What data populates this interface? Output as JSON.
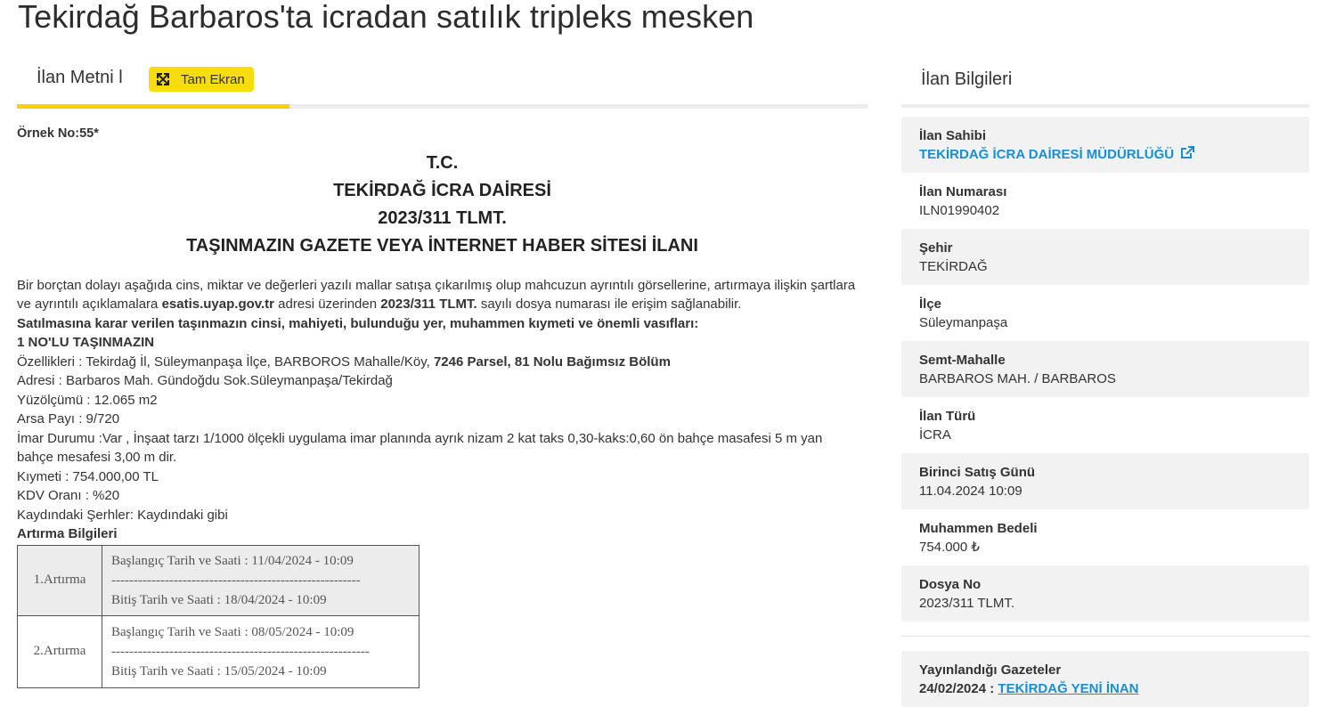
{
  "page": {
    "title": "Tekirdağ Barbaros'ta icradan satılık tripleks mesken"
  },
  "tabs": {
    "label": "İlan Metni l",
    "fullscreen_label": "Tam Ekran"
  },
  "document": {
    "ornek_no": "Örnek No:55*",
    "header_lines": [
      "T.C.",
      "TEKİRDAĞ İCRA DAİRESİ",
      "2023/311 TLMT.",
      "TAŞINMAZIN GAZETE VEYA İNTERNET HABER SİTESİ İLANI"
    ],
    "intro_1": "Bir borçtan dolayı aşağıda cins, miktar ve değerleri yazılı mallar satışa çıkarılmış olup mahcuzun ayrıntılı görsellerine, artırmaya ilişkin şartlara ve ayrıntılı açıklamalara ",
    "intro_site": "esatis.uyap.gov.tr",
    "intro_2": " adresi üzerinden ",
    "intro_file": "2023/311 TLMT.",
    "intro_3": " sayılı dosya numarası ile erişim sağlanabilir.",
    "bold_heading": "Satılmasına karar verilen taşınmazın cinsi, mahiyeti, bulunduğu yer, muhammen kıymeti ve önemli vasıfları:",
    "item_title": "1 NO'LU TAŞINMAZIN",
    "ozellik_prefix": "Özellikleri : Tekirdağ İl, Süleymanpaşa İlçe, BARBOROS Mahalle/Köy, ",
    "ozellik_bold": "7246 Parsel, 81 Nolu Bağımsız Bölüm",
    "lines": [
      "Adresi : Barbaros Mah. Gündoğdu Sok.Süleymanpaşa/Tekirdağ",
      "Yüzölçümü : 12.065 m2",
      "Arsa Payı : 9/720",
      "İmar Durumu :Var , İnşaat tarzı 1/1000 ölçekli uygulama imar planında ayrık nizam 2 kat taks 0,30-kaks:0,60 ön bahçe masafesi 5 m yan bahçe mesafesi 3,00 m dir.",
      "Kıymeti : 754.000,00 TL",
      "KDV Oranı : %20",
      "Kaydındaki Şerhler: Kaydındaki gibi"
    ],
    "auction_heading": "Artırma Bilgileri",
    "auctions": [
      {
        "name": "1.Artırma",
        "start": "Başlangıç Tarih ve Saati : 11/04/2024 - 10:09",
        "dashes": "--------------------------------------------------------",
        "end": "Bitiş Tarih ve Saati : 18/04/2024 - 10:09"
      },
      {
        "name": "2.Artırma",
        "start": "Başlangıç Tarih ve Saati : 08/05/2024 - 10:09",
        "dashes": "----------------------------------------------------------",
        "end": "Bitiş Tarih ve Saati : 15/05/2024 - 10:09"
      }
    ]
  },
  "sidebar": {
    "title": "İlan Bilgileri",
    "owner_label": "İlan Sahibi",
    "owner_value": "TEKİRDAĞ İCRA DAİRESİ MÜDÜRLÜĞÜ",
    "fields": [
      {
        "label": "İlan Numarası",
        "value": "ILN01990402"
      },
      {
        "label": "Şehir",
        "value": "TEKİRDAĞ"
      },
      {
        "label": "İlçe",
        "value": "Süleymanpaşa"
      },
      {
        "label": "Semt-Mahalle",
        "value": "BARBAROS MAH. / BARBAROS"
      },
      {
        "label": "İlan Türü",
        "value": "İCRA"
      },
      {
        "label": "Birinci Satış Günü",
        "value": "11.04.2024 10:09"
      },
      {
        "label": "Muhammen Bedeli",
        "value": "754.000 ₺"
      },
      {
        "label": "Dosya No",
        "value": "2023/311 TLMT."
      }
    ],
    "newspapers_label": "Yayınlandığı Gazeteler",
    "newspaper_date": "24/02/2024 : ",
    "newspaper_name": "TEKİRDAĞ YENİ İNAN"
  },
  "colors": {
    "accent_yellow": "#f7dc0f",
    "link_blue": "#1a8fd0",
    "card_bg": "#f2f2f2"
  }
}
